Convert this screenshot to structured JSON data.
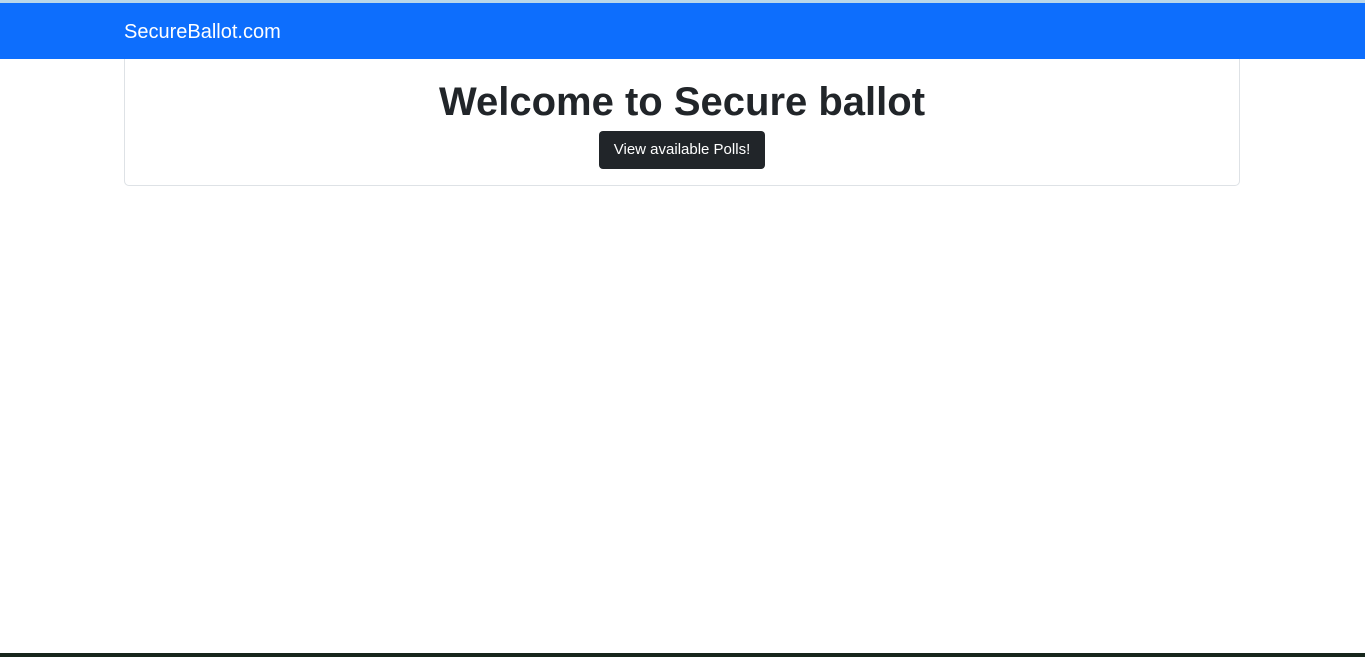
{
  "navbar": {
    "brand": "SecureBallot.com",
    "color": "#0d6efd"
  },
  "main": {
    "title": "Welcome to Secure ballot",
    "button_label": "View available Polls!"
  }
}
